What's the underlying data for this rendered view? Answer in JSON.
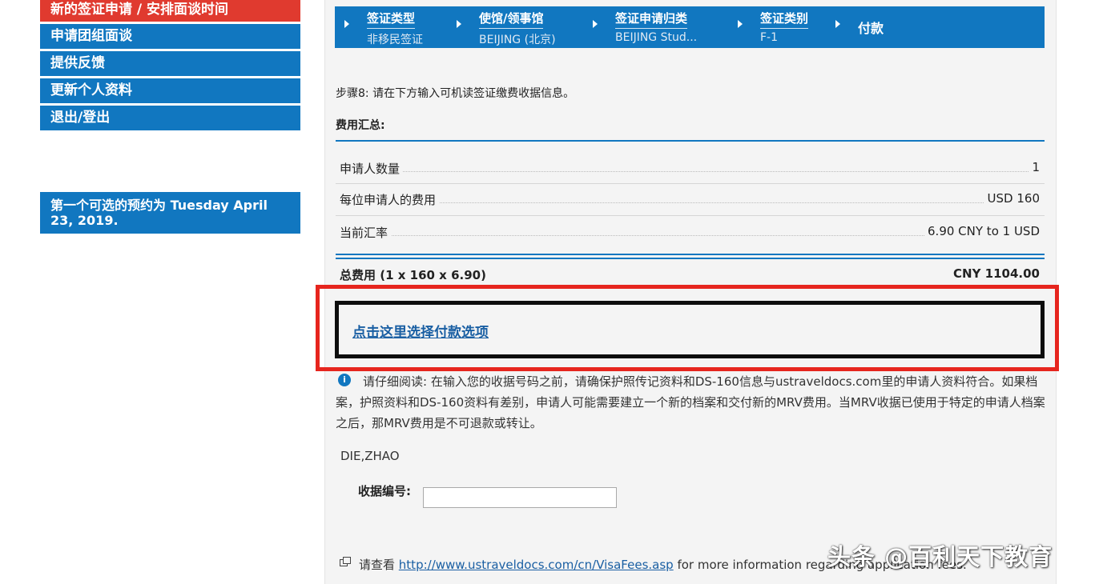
{
  "sidebar": {
    "items": [
      {
        "label": "新的签证申请 / 安排面谈时间",
        "active": true
      },
      {
        "label": "申请团组面谈",
        "active": false
      },
      {
        "label": "提供反馈",
        "active": false
      },
      {
        "label": "更新个人资料",
        "active": false
      },
      {
        "label": "退出/登出",
        "active": false
      }
    ],
    "notice": "第一个可选的预约为 Tuesday April 23, 2019."
  },
  "breadcrumb": {
    "steps": [
      {
        "title": "签证类型",
        "value": "非移民签证"
      },
      {
        "title": "使馆/领事馆",
        "value": "BEIJING (北京)"
      },
      {
        "title": "签证申请归类",
        "value": "BEIJING Stud..."
      },
      {
        "title": "签证类别",
        "value": "F-1"
      },
      {
        "title": "付款",
        "value": ""
      }
    ]
  },
  "main": {
    "step_text": "步骤8: 请在下方输入可机读签证缴费收据信息。",
    "fee_heading": "费用汇总:",
    "fees": [
      {
        "label": "申请人数量",
        "value": "1"
      },
      {
        "label": "每位申请人的费用",
        "value": "USD 160"
      },
      {
        "label": "当前汇率",
        "value": "6.90 CNY to 1 USD"
      }
    ],
    "total": {
      "label": "总费用 (1 x 160 x 6.90)",
      "value": "CNY 1104.00"
    },
    "pay_link": "点击这里选择付款选项",
    "info_icon": "info-icon",
    "notice": "请仔细阅读: 在输入您的收据号码之前，请确保护照传记资料和DS-160信息与ustraveldocs.com里的申请人资料符合。如果档案，护照资料和DS-160资料有差别，申请人可能需要建立一个新的档案和交付新的MRV费用。当MRV收据已使用于特定的申请人档案之后，那MRV费用是不可退款或转让。",
    "applicant_name": "DIE,ZHAO",
    "receipt_label": "收据编号:",
    "receipt_value": "",
    "see_prefix": "请查看",
    "see_link": "http://www.ustraveldocs.com/cn/VisaFees.asp",
    "see_suffix": "for more information regarding application fees."
  },
  "watermark": "头条 @百利天下教育",
  "colors": {
    "brand_blue": "#1177c0",
    "active_red": "#e03a2f",
    "highlight_red": "#e6251e",
    "link_blue": "#1a5fa3"
  }
}
